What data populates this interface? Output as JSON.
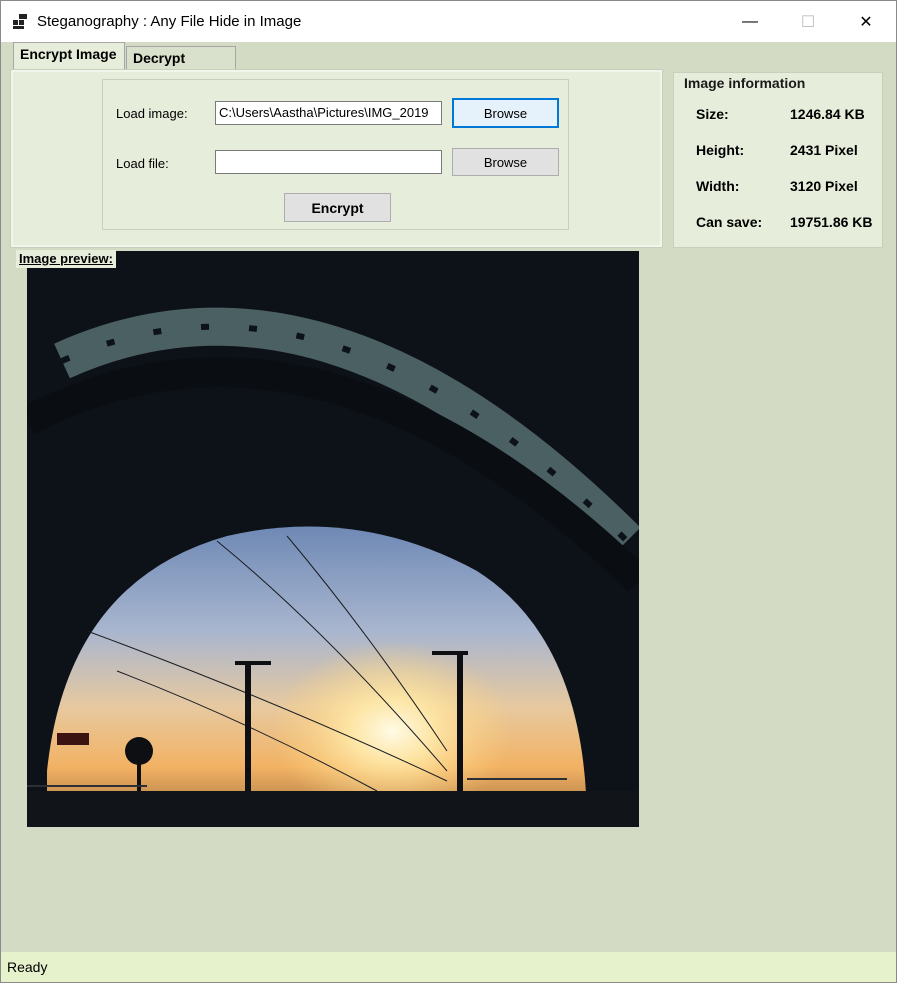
{
  "window": {
    "title": "Steganography : Any File Hide in Image",
    "controls": {
      "minimize": "—",
      "maximize": "☐",
      "close": "✕"
    }
  },
  "tabs": [
    {
      "label": "Encrypt Image",
      "active": true
    },
    {
      "label": "Decrypt Image",
      "active": false
    }
  ],
  "encrypt": {
    "load_image_label": "Load image:",
    "load_image_value": "C:\\Users\\Aastha\\Pictures\\IMG_2019",
    "load_file_label": "Load file:",
    "load_file_value": "",
    "browse_label": "Browse",
    "encrypt_label": "Encrypt"
  },
  "image_info": {
    "title": "Image information",
    "rows": [
      {
        "key": "Size:",
        "value": "1246.84 KB"
      },
      {
        "key": "Height:",
        "value": "2431 Pixel"
      },
      {
        "key": "Width:",
        "value": "3120 Pixel"
      },
      {
        "key": "Can save:",
        "value": "19751.86 KB"
      }
    ]
  },
  "preview": {
    "label": "Image preview:"
  },
  "status": {
    "text": "Ready"
  },
  "colors": {
    "window_bg": "#d4dbc4",
    "panel_bg": "#e6eddb",
    "status_bg": "#e6f2cc",
    "focus_accent": "#0078d7"
  }
}
